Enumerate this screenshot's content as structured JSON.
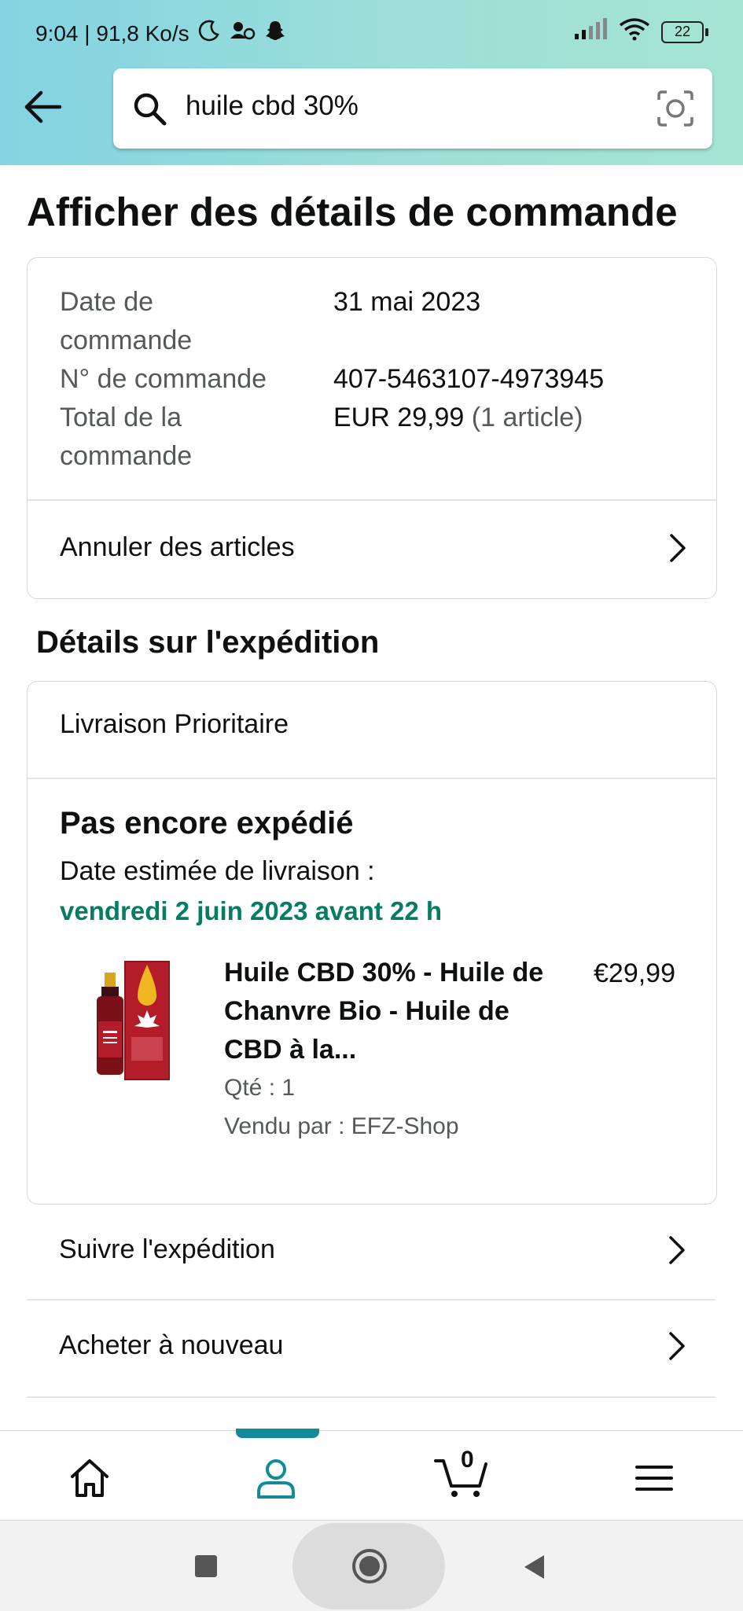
{
  "status_bar": {
    "time_speed": "9:04 | 91,8 Ko/s",
    "battery": "22"
  },
  "search": {
    "query": "huile cbd 30%"
  },
  "page_title": "Afficher des détails de commande",
  "order": {
    "date_label": "Date de commande",
    "date_value": "31 mai 2023",
    "number_label": "N° de commande",
    "number_value": "407-5463107-4973945",
    "total_label": "Total de la commande",
    "total_value": "EUR 29,99",
    "total_count": "(1 article)",
    "cancel_label": "Annuler des articles"
  },
  "shipping": {
    "section_title": "Détails sur l'expédition",
    "method": "Livraison Prioritaire",
    "status": "Pas encore expédié",
    "eta_label": "Date estimée de livraison :",
    "eta_value": "vendredi 2 juin 2023 avant 22 h",
    "product": {
      "title": "Huile CBD 30% - Huile de Chanvre Bio - Huile de CBD à la...",
      "price": "€29,99",
      "qty": "Qté : 1",
      "seller": "Vendu par : EFZ-Shop"
    }
  },
  "actions": {
    "track": "Suivre l'expédition",
    "buy_again": "Acheter à nouveau"
  },
  "bottom_nav": {
    "cart_count": "0",
    "items": [
      "home-icon",
      "account-icon",
      "cart-icon",
      "menu-icon"
    ],
    "active": "account-icon"
  },
  "colors": {
    "accent_teal": "#138a97",
    "delivery_green": "#067d62"
  }
}
